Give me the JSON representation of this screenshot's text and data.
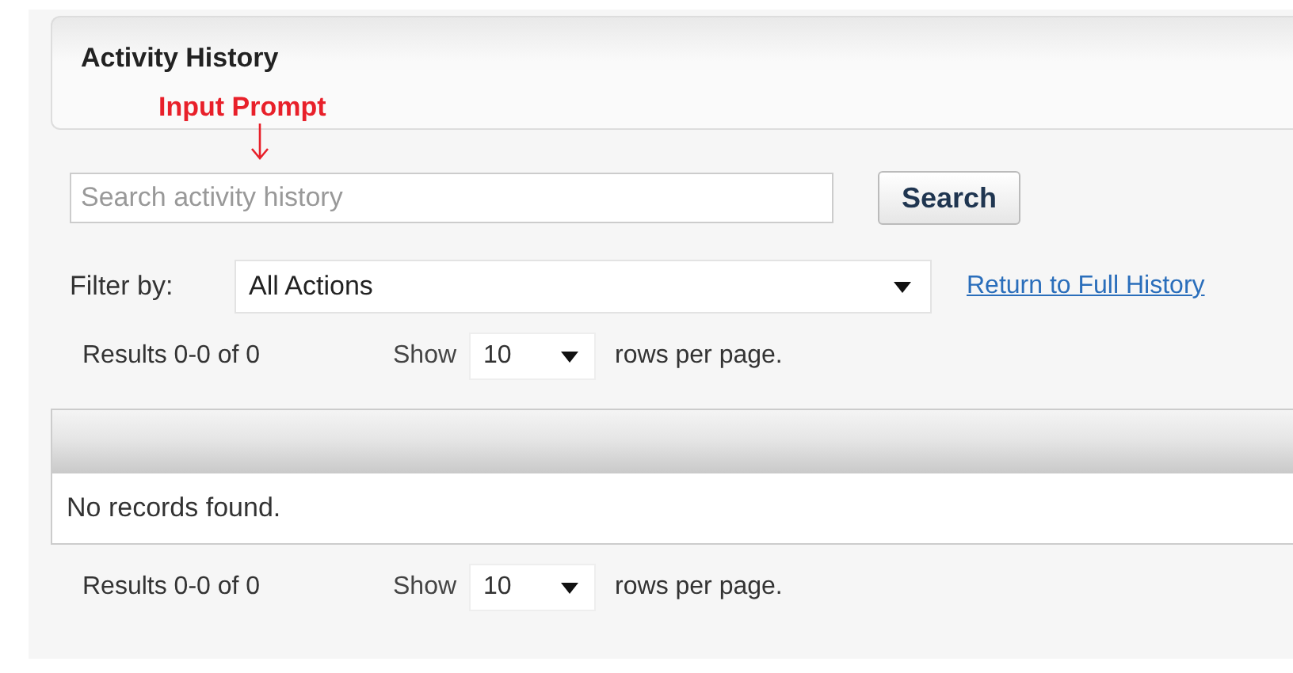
{
  "panel": {
    "title": "Activity History"
  },
  "annotation": {
    "label": "Input Prompt"
  },
  "search": {
    "placeholder": "Search activity history",
    "button": "Search"
  },
  "filter": {
    "label": "Filter by:",
    "value": "All Actions",
    "link": "Return to Full History"
  },
  "pagers": [
    {
      "results": "Results 0-0 of 0",
      "show": "Show",
      "rows": "10",
      "suffix": "rows per page."
    },
    {
      "results": "Results 0-0 of 0",
      "show": "Show",
      "rows": "10",
      "suffix": "rows per page."
    }
  ],
  "table": {
    "empty_message": "No records found."
  }
}
